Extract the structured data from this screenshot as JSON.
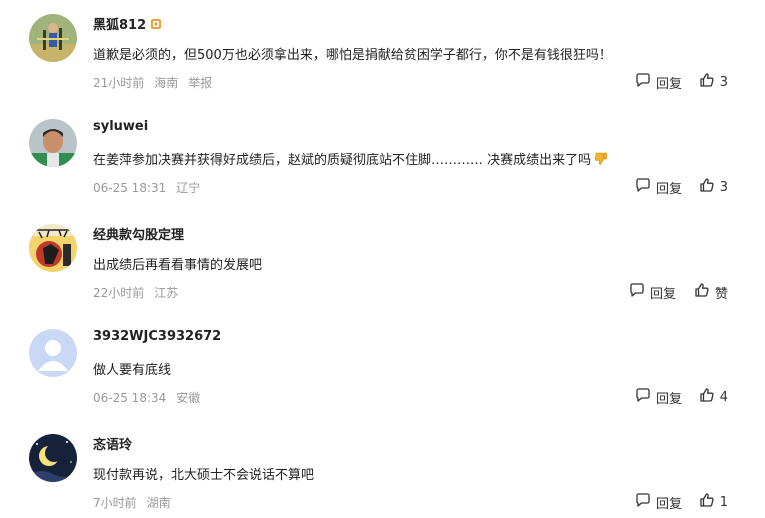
{
  "comments": [
    {
      "username": "黑狐812",
      "text": "道歉是必须的，但500万也必须拿出来，哪怕是捐献给贫困学子都行，你不是有钱很狂吗！",
      "time": "21小时前",
      "location": "海南",
      "report": "举报",
      "reply": "回复",
      "likes": "3"
    },
    {
      "username": "syluwei",
      "text": "在姜萍参加决赛并获得好成绩后，赵斌的质疑彻底站不住脚………… 决赛成绩出来了吗",
      "time": "06-25 18:31",
      "location": "辽宁",
      "reply": "回复",
      "likes": "3"
    },
    {
      "username": "经典款勾股定理",
      "text": "出成绩后再看看事情的发展吧",
      "time": "22小时前",
      "location": "江苏",
      "reply": "回复",
      "likes": "赞"
    },
    {
      "username": "3932WJC3932672",
      "text": "做人要有底线",
      "time": "06-25 18:34",
      "location": "安徽",
      "reply": "回复",
      "likes": "4"
    },
    {
      "username": "忞语玲",
      "text": "现付款再说，北大硕士不会说话不算吧",
      "time": "7小时前",
      "location": "湖南",
      "reply": "回复",
      "likes": "1"
    }
  ],
  "colors": {
    "meta": "#999999",
    "text": "#222222"
  }
}
